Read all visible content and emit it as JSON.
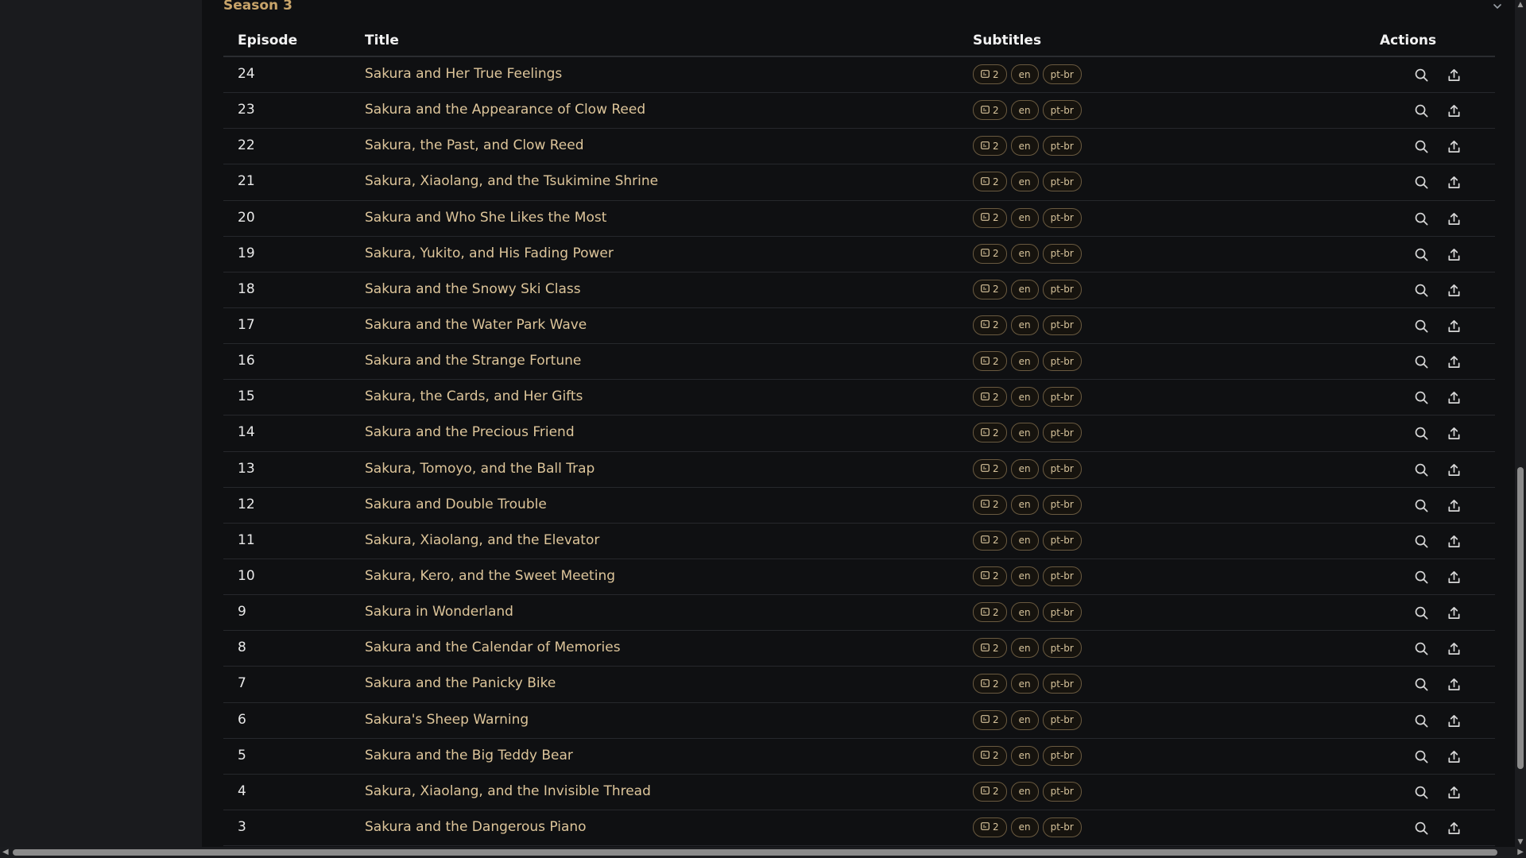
{
  "season": {
    "title": "Season 3",
    "chevron_icon": "chevron-down-icon"
  },
  "table": {
    "headers": {
      "episode": "Episode",
      "title": "Title",
      "subtitles": "Subtitles",
      "actions": "Actions"
    },
    "rows": [
      {
        "episode": "24",
        "title": "Sakura and Her True Feelings",
        "sub_count": "2",
        "langs": [
          "en",
          "pt-br"
        ]
      },
      {
        "episode": "23",
        "title": "Sakura and the Appearance of Clow Reed",
        "sub_count": "2",
        "langs": [
          "en",
          "pt-br"
        ]
      },
      {
        "episode": "22",
        "title": "Sakura, the Past, and Clow Reed",
        "sub_count": "2",
        "langs": [
          "en",
          "pt-br"
        ]
      },
      {
        "episode": "21",
        "title": "Sakura, Xiaolang, and the Tsukimine Shrine",
        "sub_count": "2",
        "langs": [
          "en",
          "pt-br"
        ]
      },
      {
        "episode": "20",
        "title": "Sakura and Who She Likes the Most",
        "sub_count": "2",
        "langs": [
          "en",
          "pt-br"
        ]
      },
      {
        "episode": "19",
        "title": "Sakura, Yukito, and His Fading Power",
        "sub_count": "2",
        "langs": [
          "en",
          "pt-br"
        ]
      },
      {
        "episode": "18",
        "title": "Sakura and the Snowy Ski Class",
        "sub_count": "2",
        "langs": [
          "en",
          "pt-br"
        ]
      },
      {
        "episode": "17",
        "title": "Sakura and the Water Park Wave",
        "sub_count": "2",
        "langs": [
          "en",
          "pt-br"
        ]
      },
      {
        "episode": "16",
        "title": "Sakura and the Strange Fortune",
        "sub_count": "2",
        "langs": [
          "en",
          "pt-br"
        ]
      },
      {
        "episode": "15",
        "title": "Sakura, the Cards, and Her Gifts",
        "sub_count": "2",
        "langs": [
          "en",
          "pt-br"
        ]
      },
      {
        "episode": "14",
        "title": "Sakura and the Precious Friend",
        "sub_count": "2",
        "langs": [
          "en",
          "pt-br"
        ]
      },
      {
        "episode": "13",
        "title": "Sakura, Tomoyo, and the Ball Trap",
        "sub_count": "2",
        "langs": [
          "en",
          "pt-br"
        ]
      },
      {
        "episode": "12",
        "title": "Sakura and Double Trouble",
        "sub_count": "2",
        "langs": [
          "en",
          "pt-br"
        ]
      },
      {
        "episode": "11",
        "title": "Sakura, Xiaolang, and the Elevator",
        "sub_count": "2",
        "langs": [
          "en",
          "pt-br"
        ]
      },
      {
        "episode": "10",
        "title": "Sakura, Kero, and the Sweet Meeting",
        "sub_count": "2",
        "langs": [
          "en",
          "pt-br"
        ]
      },
      {
        "episode": "9",
        "title": "Sakura in Wonderland",
        "sub_count": "2",
        "langs": [
          "en",
          "pt-br"
        ]
      },
      {
        "episode": "8",
        "title": "Sakura and the Calendar of Memories",
        "sub_count": "2",
        "langs": [
          "en",
          "pt-br"
        ]
      },
      {
        "episode": "7",
        "title": "Sakura and the Panicky Bike",
        "sub_count": "2",
        "langs": [
          "en",
          "pt-br"
        ]
      },
      {
        "episode": "6",
        "title": "Sakura's Sheep Warning",
        "sub_count": "2",
        "langs": [
          "en",
          "pt-br"
        ]
      },
      {
        "episode": "5",
        "title": "Sakura and the Big Teddy Bear",
        "sub_count": "2",
        "langs": [
          "en",
          "pt-br"
        ]
      },
      {
        "episode": "4",
        "title": "Sakura, Xiaolang, and the Invisible Thread",
        "sub_count": "2",
        "langs": [
          "en",
          "pt-br"
        ]
      },
      {
        "episode": "3",
        "title": "Sakura and the Dangerous Piano",
        "sub_count": "2",
        "langs": [
          "en",
          "pt-br"
        ]
      }
    ],
    "row_action_icons": [
      "search-icon",
      "upload-icon"
    ]
  },
  "colors": {
    "accent": "#c8a46a",
    "title_text": "#ddc59a",
    "background": "#0f1012"
  }
}
